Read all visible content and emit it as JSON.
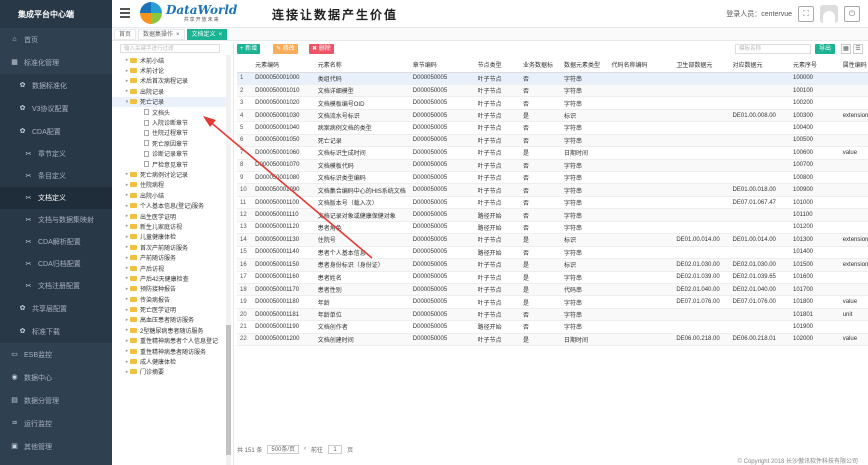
{
  "sidebar": {
    "title": "集成平台中心端",
    "items": [
      {
        "label": "首页",
        "icon": "home-icon",
        "level": 0
      },
      {
        "label": "标准化管理",
        "icon": "grid-icon",
        "level": 0
      },
      {
        "label": "数据标准化",
        "icon": "gear-icon",
        "level": 1
      },
      {
        "label": "V3协议配置",
        "icon": "gear-icon",
        "level": 1
      },
      {
        "label": "CDA配置",
        "icon": "gear-icon",
        "level": 1
      },
      {
        "label": "章节定义",
        "icon": "wrench-icon",
        "level": 2
      },
      {
        "label": "条目定义",
        "icon": "wrench-icon",
        "level": 2
      },
      {
        "label": "文档定义",
        "icon": "wrench-icon",
        "level": 2,
        "active": true
      },
      {
        "label": "文档与数据集映射",
        "icon": "wrench-icon",
        "level": 2
      },
      {
        "label": "CDA解析配置",
        "icon": "wrench-icon",
        "level": 2
      },
      {
        "label": "CDA归档配置",
        "icon": "wrench-icon",
        "level": 2
      },
      {
        "label": "文档注册配置",
        "icon": "wrench-icon",
        "level": 2
      },
      {
        "label": "共享层配置",
        "icon": "gear-icon",
        "level": 1
      },
      {
        "label": "标准下载",
        "icon": "gear-icon",
        "level": 1
      },
      {
        "label": "ESB监控",
        "icon": "monitor-icon",
        "level": 0
      },
      {
        "label": "数据中心",
        "icon": "database-icon",
        "level": 0
      },
      {
        "label": "数据分管理",
        "icon": "chart-icon",
        "level": 0
      },
      {
        "label": "运行监控",
        "icon": "pulse-icon",
        "level": 0
      },
      {
        "label": "其他管理",
        "icon": "folder-icon",
        "level": 0
      }
    ]
  },
  "header": {
    "logo_text": "DataWorld",
    "logo_sub": "共享开放未来",
    "slogan": "连接让数据产生价值",
    "login_label": "登录人员：centervue"
  },
  "tabs": [
    {
      "label": "首页",
      "active": false
    },
    {
      "label": "数据集操作",
      "active": false,
      "closable": true
    },
    {
      "label": "文档定义",
      "active": true,
      "closable": true
    }
  ],
  "tree": {
    "search_placeholder": "输入关键字进行过滤",
    "nodes": [
      {
        "label": "术前小结",
        "type": "folder",
        "depth": 1
      },
      {
        "label": "术前讨论",
        "type": "folder",
        "depth": 1
      },
      {
        "label": "术后首次病程记录",
        "type": "folder",
        "depth": 1
      },
      {
        "label": "出院记录",
        "type": "folder",
        "depth": 1
      },
      {
        "label": "死亡记录",
        "type": "folder",
        "depth": 1,
        "open": true,
        "selected": true
      },
      {
        "label": "文档头",
        "type": "file",
        "depth": 2
      },
      {
        "label": "入院诊断章节",
        "type": "file",
        "depth": 2
      },
      {
        "label": "住院过程章节",
        "type": "file",
        "depth": 2
      },
      {
        "label": "死亡原因章节",
        "type": "file",
        "depth": 2
      },
      {
        "label": "诊断记录章节",
        "type": "file",
        "depth": 2
      },
      {
        "label": "尸检意见章节",
        "type": "file",
        "depth": 2
      },
      {
        "label": "死亡病例讨论记录",
        "type": "folder",
        "depth": 1
      },
      {
        "label": "住院病程",
        "type": "folder",
        "depth": 1
      },
      {
        "label": "出院小结",
        "type": "folder",
        "depth": 1
      },
      {
        "label": "个人基本信息(登记)服务",
        "type": "folder",
        "depth": 1
      },
      {
        "label": "出生医学证明",
        "type": "folder",
        "depth": 1
      },
      {
        "label": "新生儿家庭访视",
        "type": "folder",
        "depth": 1
      },
      {
        "label": "儿童健康体检",
        "type": "folder",
        "depth": 1
      },
      {
        "label": "首次产前随访服务",
        "type": "folder",
        "depth": 1
      },
      {
        "label": "产前随访服务",
        "type": "folder",
        "depth": 1
      },
      {
        "label": "产后访视",
        "type": "folder",
        "depth": 1
      },
      {
        "label": "产后42天健康检查",
        "type": "folder",
        "depth": 1
      },
      {
        "label": "预防接种报告",
        "type": "folder",
        "depth": 1
      },
      {
        "label": "传染病报告",
        "type": "folder",
        "depth": 1
      },
      {
        "label": "死亡医学证明",
        "type": "folder",
        "depth": 1
      },
      {
        "label": "高血压患者随访服务",
        "type": "folder",
        "depth": 1
      },
      {
        "label": "2型糖尿病患者随访服务",
        "type": "folder",
        "depth": 1
      },
      {
        "label": "重性精神病患者个人信息登记",
        "type": "folder",
        "depth": 1
      },
      {
        "label": "重性精神病患者随访服务",
        "type": "folder",
        "depth": 1
      },
      {
        "label": "成人健康体检",
        "type": "folder",
        "depth": 1
      },
      {
        "label": "门诊摘要",
        "type": "folder",
        "depth": 1
      }
    ]
  },
  "toolbar": {
    "add": "+ 新增",
    "edit": "✎ 修改",
    "del": "✖ 删除",
    "search_placeholder": "模板名称",
    "export": "导出",
    "add_color": "#1ab394",
    "edit_color": "#f8ac59",
    "del_color": "#ed5565",
    "export_color": "#1ab394"
  },
  "table": {
    "columns": [
      "",
      "元素编码",
      "元素名称",
      "章节编码",
      "节点类型",
      "业务数据标",
      "数据元素类型",
      "代码名称编码",
      "卫生部数据元",
      "对应数据元",
      "元素序号",
      "属性编码",
      "值类型"
    ],
    "rows": [
      [
        "1",
        "D000050001000",
        "类组代码",
        "D000050005",
        "叶子节点",
        "否",
        "字符串",
        "",
        "",
        "",
        "100000",
        "",
        "code"
      ],
      [
        "2",
        "D000050001010",
        "文档详细模型",
        "D000050005",
        "叶子节点",
        "否",
        "字符串",
        "",
        "",
        "",
        "100100",
        "",
        "root"
      ],
      [
        "3",
        "D000050001020",
        "文档模板编号OID",
        "D000050005",
        "叶子节点",
        "否",
        "字符串",
        "",
        "",
        "",
        "100200",
        "",
        "root"
      ],
      [
        "4",
        "D000050001030",
        "文档流水号标识",
        "D000050005",
        "叶子节点",
        "是",
        "标识",
        "",
        "",
        "DE01.00.008.00",
        "100300",
        "extension",
        "root"
      ],
      [
        "5",
        "D000050001040",
        "病案病例文档的类型",
        "D000050005",
        "叶子节点",
        "否",
        "字符串",
        "",
        "",
        "",
        "100400",
        "",
        "code"
      ],
      [
        "6",
        "D000050001050",
        "死亡记录",
        "D000050005",
        "叶子节点",
        "否",
        "字符串",
        "",
        "",
        "",
        "100500",
        "",
        ""
      ],
      [
        "7",
        "D000050001060",
        "文档标识生成时间",
        "D000050005",
        "叶子节点",
        "是",
        "日期时间",
        "",
        "",
        "",
        "100600",
        "value",
        ""
      ],
      [
        "8",
        "D000050001070",
        "文档模板代码",
        "D000050005",
        "叶子节点",
        "否",
        "字符串",
        "",
        "",
        "",
        "100700",
        "",
        "code"
      ],
      [
        "9",
        "D000050001080",
        "文档标识类型编码",
        "D000050005",
        "叶子节点",
        "否",
        "字符串",
        "",
        "",
        "",
        "100800",
        "",
        "code"
      ],
      [
        "10",
        "D000050001090",
        "文档集合编码中心的HIS系统文档",
        "D000050005",
        "叶子节点",
        "否",
        "字符串",
        "",
        "",
        "DE01.00.018.00",
        "100900",
        "",
        ""
      ],
      [
        "11",
        "D000050001100",
        "文档版本号（载入次）",
        "D000050005",
        "叶子节点",
        "否",
        "字符串",
        "",
        "",
        "DE07.01.067.47",
        "101000",
        "",
        ""
      ],
      [
        "12",
        "D000050001110",
        "文档记录对象或健康保健对象",
        "D000050005",
        "路径开始",
        "否",
        "字符串",
        "",
        "",
        "",
        "101100",
        "",
        "type"
      ],
      [
        "13",
        "D000050001120",
        "患者角色",
        "D000050005",
        "路径开始",
        "否",
        "字符串",
        "",
        "",
        "",
        "101200",
        "",
        "class"
      ],
      [
        "14",
        "D000050001130",
        "住院号",
        "D000050005",
        "叶子节点",
        "是",
        "标识",
        "",
        "DE01.00.014.00",
        "DE01.00.014.00",
        "101300",
        "extension",
        "root"
      ],
      [
        "15",
        "D000050001140",
        "患者个人基本信息",
        "D000050005",
        "路径开始",
        "否",
        "字符串",
        "",
        "",
        "",
        "101400",
        "",
        "class"
      ],
      [
        "16",
        "D000050001150",
        "患者身份标识（身份证）",
        "D000050005",
        "叶子节点",
        "是",
        "标识",
        "",
        "DE02.01.030.00",
        "DE02.01.030.00",
        "101500",
        "extension",
        "root"
      ],
      [
        "17",
        "D000050001160",
        "患者姓名",
        "D000050005",
        "叶子节点",
        "是",
        "字符串",
        "",
        "DE02.01.039.00",
        "DE02.01.039.65",
        "101600",
        "",
        ""
      ],
      [
        "18",
        "D000050001170",
        "患者性别",
        "D000050005",
        "叶子节点",
        "是",
        "代码串",
        "",
        "DE02.01.040.00",
        "DE02.01.040.00",
        "101700",
        "",
        "code"
      ],
      [
        "19",
        "D000050001180",
        "年龄",
        "D000050005",
        "叶子节点",
        "是",
        "字符串",
        "",
        "DE07.01.076.00",
        "DE07.01.076.00",
        "101800",
        "value",
        "type"
      ],
      [
        "20",
        "D000050001181",
        "年龄单位",
        "D000050005",
        "叶子节点",
        "否",
        "字符串",
        "",
        "",
        "",
        "101801",
        "unit",
        ""
      ],
      [
        "21",
        "D000050001190",
        "文档创作者",
        "D000050005",
        "路径开始",
        "否",
        "字符串",
        "",
        "",
        "",
        "101900",
        "",
        "type"
      ],
      [
        "22",
        "D000050001200",
        "文档创建时间",
        "D000050005",
        "叶子节点",
        "是",
        "日期时间",
        "",
        "DE06.00.218.00",
        "DE06.00.218.01",
        "102000",
        "value",
        ""
      ]
    ]
  },
  "pager": {
    "total": "共 151 条",
    "page_size": "500条/页",
    "prev": "前往",
    "page": "1",
    "suffix": "页"
  },
  "footer": "© Copyright 2018 长沙傲讯软件科技有限公司"
}
